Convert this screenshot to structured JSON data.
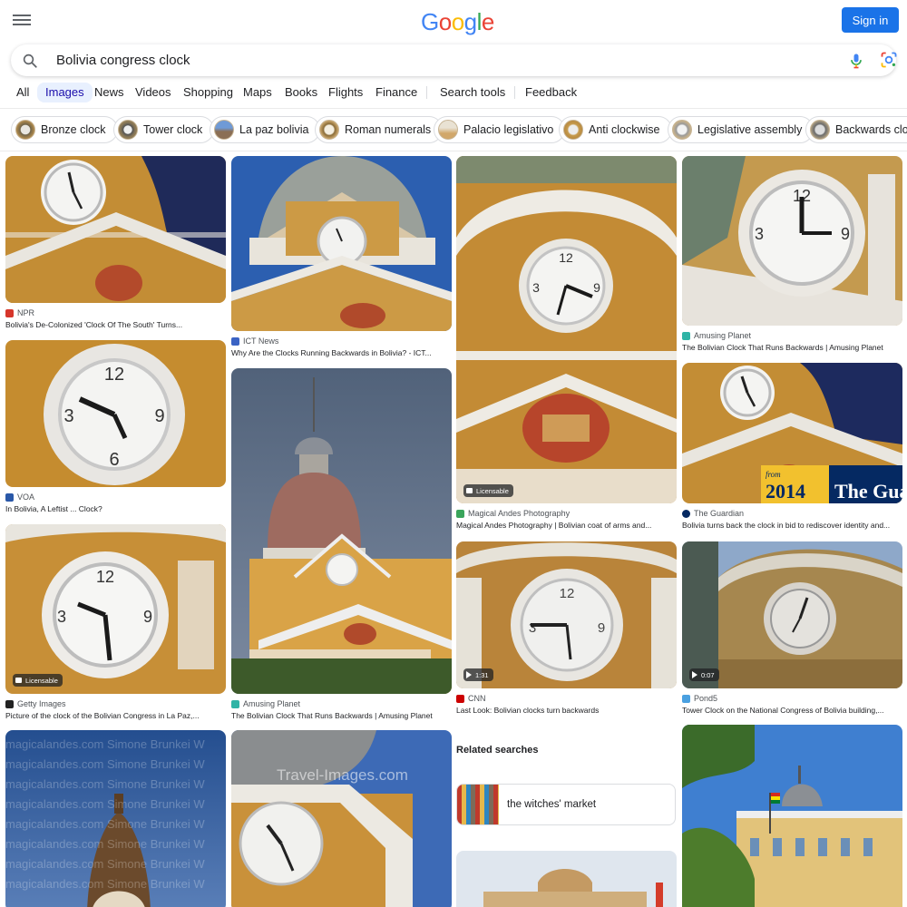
{
  "header": {
    "logo": [
      "G",
      "o",
      "o",
      "g",
      "l",
      "e"
    ],
    "logo_colors": [
      "#4285F4",
      "#EA4335",
      "#FBBC05",
      "#4285F4",
      "#34A853",
      "#EA4335"
    ],
    "sign_in": "Sign in",
    "accent": "#1a73e8"
  },
  "search": {
    "query": "Bolivia congress clock"
  },
  "tabs": [
    {
      "label": "All"
    },
    {
      "label": "Images",
      "active": true
    },
    {
      "label": "News"
    },
    {
      "label": "Videos"
    },
    {
      "label": "Shopping"
    },
    {
      "label": "Maps"
    },
    {
      "label": "Books"
    },
    {
      "label": "Flights"
    },
    {
      "label": "Finance"
    },
    {
      "label": "Search tools"
    },
    {
      "label": "Feedback"
    }
  ],
  "chips": [
    {
      "label": "Bronze clock"
    },
    {
      "label": "Tower clock"
    },
    {
      "label": "La paz bolivia"
    },
    {
      "label": "Roman numerals"
    },
    {
      "label": "Palacio legislativo"
    },
    {
      "label": "Anti clockwise"
    },
    {
      "label": "Legislative assembly"
    },
    {
      "label": "Backwards clock"
    }
  ],
  "results": [
    {
      "source": "NPR",
      "caption": "Bolivia's De-Colonized 'Clock Of The South' Turns...",
      "source_color": "#d6362b"
    },
    {
      "source": "VOA",
      "caption": "In Bolivia, A Leftist ... Clock?",
      "source_color": "#2a58a8"
    },
    {
      "source": "Getty Images",
      "caption": "Picture of the clock of the Bolivian Congress in La Paz,...",
      "badge": "Licensable",
      "source_color": "#222222"
    },
    {
      "source": "ICT News",
      "caption": "Why Are the Clocks Running Backwards in Bolivia? - ICT...",
      "source_color": "#3b63c4"
    },
    {
      "source": "Amusing Planet",
      "caption": "The Bolivian Clock That Runs Backwards | Amusing Planet",
      "source_color": "#2fb4a6"
    },
    {
      "source": "Magical Andes Photography",
      "caption": "Magical Andes Photography | Bolivian coat of arms and...",
      "badge": "Licensable",
      "source_color": "#3aa55b"
    },
    {
      "source": "CNN",
      "caption": "Last Look: Bolivian clocks turn backwards",
      "badge": "1:31",
      "source_color": "#cc0000"
    },
    {
      "source": "Amusing Planet",
      "caption": "The Bolivian Clock That Runs Backwards | Amusing Planet",
      "source_color": "#2fb4a6"
    },
    {
      "source": "The Guardian",
      "caption": "Bolivia turns back the clock in bid to rediscover identity and...",
      "overlay_year": "2014",
      "overlay_from": "from",
      "overlay_brand": "The Guardia",
      "source_color": "#052962"
    },
    {
      "source": "Pond5",
      "caption": "Tower Clock on the National Congress of Bolivia building,...",
      "badge": "0:07",
      "source_color": "#4aa0e0"
    }
  ],
  "watermarks": {
    "dreamstime": "magicalandes.com  Simone Brunkei  W",
    "travel": "Travel-Images.com"
  },
  "related": {
    "title": "Related searches",
    "items": [
      {
        "label": "the witches' market"
      }
    ]
  }
}
